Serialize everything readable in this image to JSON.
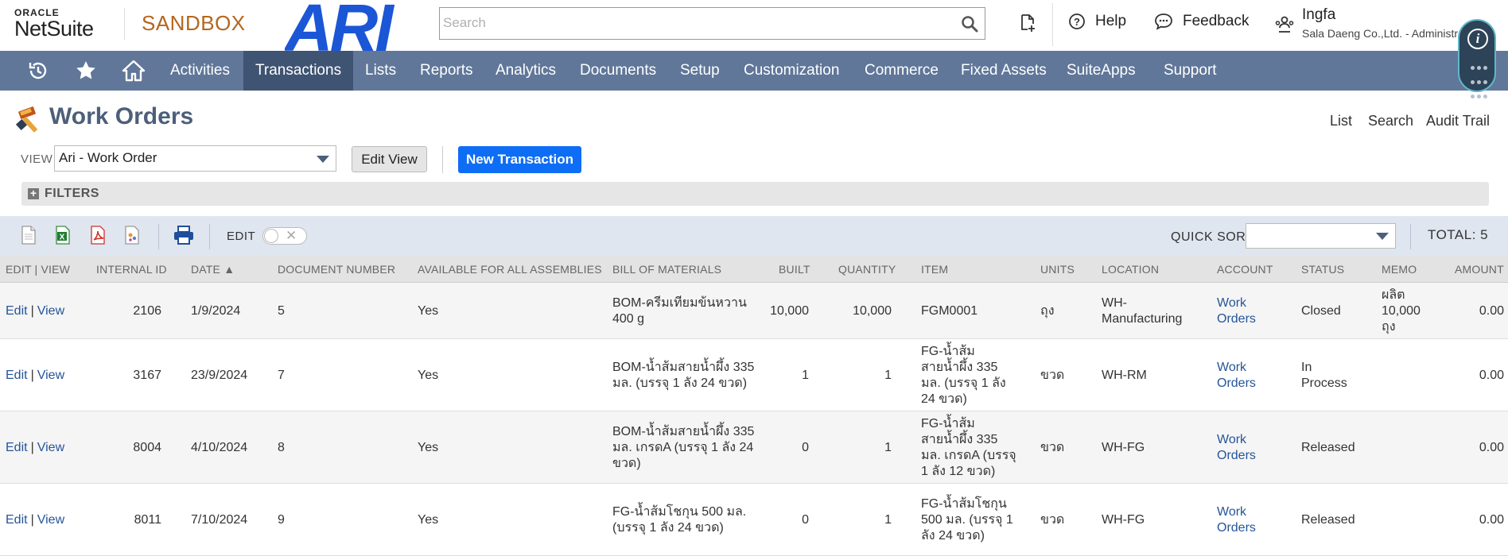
{
  "header": {
    "oracle_label": "ORACLE",
    "netsuite_label": "NetSuite",
    "sandbox_label": "SANDBOX",
    "company_logo_text": "ARI",
    "search_placeholder": "Search",
    "help_label": "Help",
    "feedback_label": "Feedback",
    "user_name": "Ingfa",
    "user_sub": "Sala Daeng Co.,Ltd. - Administrator"
  },
  "nav": {
    "items": [
      "Activities",
      "Transactions",
      "Lists",
      "Reports",
      "Analytics",
      "Documents",
      "Setup",
      "Customization",
      "Commerce",
      "Fixed Assets",
      "SuiteApps",
      "Support"
    ],
    "active": "Transactions"
  },
  "page": {
    "title": "Work Orders",
    "links": [
      "List",
      "Search",
      "Audit Trail"
    ],
    "view_label": "VIEW",
    "view_value": "Ari - Work Order",
    "edit_view_label": "Edit View",
    "new_transaction_label": "New Transaction",
    "filters_label": "FILTERS"
  },
  "toolbar": {
    "edit_label": "EDIT",
    "quick_sort_label": "QUICK SORT",
    "quick_sort_value": "",
    "total_label": "TOTAL: 5"
  },
  "table": {
    "headers": [
      "EDIT | VIEW",
      "INTERNAL ID",
      "DATE ▲",
      "DOCUMENT NUMBER",
      "AVAILABLE FOR ALL ASSEMBLIES",
      "BILL OF MATERIALS",
      "BUILT",
      "QUANTITY",
      "ITEM",
      "UNITS",
      "LOCATION",
      "ACCOUNT",
      "STATUS",
      "MEMO",
      "AMOUNT"
    ],
    "edit_text": "Edit",
    "view_text": "View",
    "rows": [
      {
        "id": "2106",
        "date": "1/9/2024",
        "doc": "5",
        "avail": "Yes",
        "bom": [
          "BOM-ครีมเทียมข้นหวาน",
          "400 g"
        ],
        "built": "10,000",
        "qty": "10,000",
        "item": [
          "FGM0001"
        ],
        "units": "ถุง",
        "location": [
          "WH-",
          "Manufacturing"
        ],
        "account": [
          "Work",
          "Orders"
        ],
        "status": [
          "Closed"
        ],
        "memo": [
          "ผลิต",
          "10,000",
          "ถุง"
        ],
        "amount": "0.00"
      },
      {
        "id": "3167",
        "date": "23/9/2024",
        "doc": "7",
        "avail": "Yes",
        "bom": [
          "BOM-น้ำส้มสายน้ำผึ้ง 335",
          "มล. (บรรจุ 1 ลัง 24 ขวด)"
        ],
        "built": "1",
        "qty": "1",
        "item": [
          "FG-น้ำส้ม",
          "สายน้ำผึ้ง 335",
          "มล. (บรรจุ 1 ลัง",
          "24 ขวด)"
        ],
        "units": "ขวด",
        "location": [
          "WH-RM"
        ],
        "account": [
          "Work",
          "Orders"
        ],
        "status": [
          "In",
          "Process"
        ],
        "memo": [],
        "amount": "0.00"
      },
      {
        "id": "8004",
        "date": "4/10/2024",
        "doc": "8",
        "avail": "Yes",
        "bom": [
          "BOM-น้ำส้มสายน้ำผึ้ง 335",
          "มล. เกรดA (บรรจุ 1 ลัง 24",
          "ขวด)"
        ],
        "built": "0",
        "qty": "1",
        "item": [
          "FG-น้ำส้ม",
          "สายน้ำผึ้ง 335",
          "มล. เกรดA (บรรจุ",
          "1 ลัง 12 ขวด)"
        ],
        "units": "ขวด",
        "location": [
          "WH-FG"
        ],
        "account": [
          "Work",
          "Orders"
        ],
        "status": [
          "Released"
        ],
        "memo": [],
        "amount": "0.00"
      },
      {
        "id": "8011",
        "date": "7/10/2024",
        "doc": "9",
        "avail": "Yes",
        "bom": [
          "FG-น้ำส้มโชกุน 500 มล.",
          "(บรรจุ 1 ลัง 24 ขวด)"
        ],
        "built": "0",
        "qty": "1",
        "item": [
          "FG-น้ำส้มโชกุน",
          "500 มล. (บรรจุ 1",
          "ลัง 24 ขวด)"
        ],
        "units": "ขวด",
        "location": [
          "WH-FG"
        ],
        "account": [
          "Work",
          "Orders"
        ],
        "status": [
          "Released"
        ],
        "memo": [],
        "amount": "0.00"
      }
    ]
  },
  "colors": {
    "nav_bg": "#607799",
    "nav_active": "#3f5472",
    "primary_button": "#0e6df5",
    "link": "#255599",
    "sandbox": "#b5651d",
    "ari_logo": "#1b56d6"
  }
}
